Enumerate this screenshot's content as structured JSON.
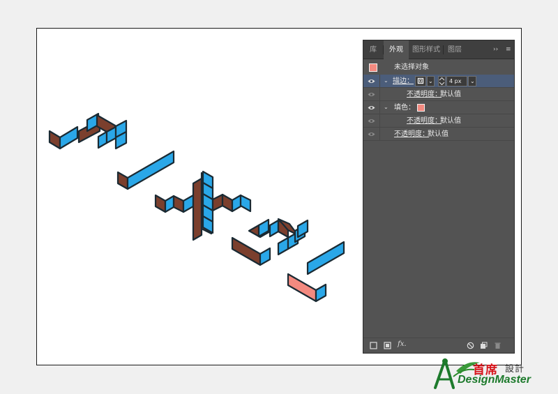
{
  "colors": {
    "face_blue": "#2aa7e8",
    "side_brown": "#7b3f2d",
    "accent_pink": "#f38a80",
    "outline": "#1a2a33"
  },
  "panel": {
    "tabs": [
      "库",
      "外观",
      "图形样式",
      "图层"
    ],
    "active_tab": "外观",
    "header_controls": {
      "collapse": "››",
      "menu": "≡"
    },
    "header_row": {
      "label": "未选择对象"
    },
    "stroke_row": {
      "label": "描边：",
      "weight_value": "4 px"
    },
    "stroke_opacity": {
      "label": "不透明度：",
      "value": "默认值"
    },
    "fill_row": {
      "label": "填色："
    },
    "fill_opacity": {
      "label": "不透明度：",
      "value": "默认值"
    },
    "object_opacity": {
      "label": "不透明度：",
      "value": "默认值"
    },
    "bottom_icons": [
      "new-stroke-icon",
      "new-fill-icon",
      "fx-icon",
      "clear-icon",
      "duplicate-icon",
      "delete-icon"
    ],
    "fx_label": "fx."
  },
  "logo": {
    "cn_brand": "首席",
    "cn_suffix": "設計",
    "en": "DesignMaster"
  }
}
